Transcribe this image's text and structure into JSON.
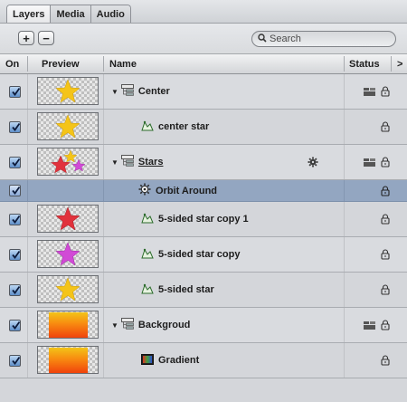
{
  "tabs": [
    {
      "label": "Layers",
      "active": true
    },
    {
      "label": "Media",
      "active": false
    },
    {
      "label": "Audio",
      "active": false
    }
  ],
  "toolbar": {
    "add_label": "+",
    "remove_label": "−",
    "search_placeholder": "Search",
    "search_value": ""
  },
  "columns": {
    "on": "On",
    "preview": "Preview",
    "name": "Name",
    "status": "Status",
    "more": ">"
  },
  "rows": [
    {
      "name": "Center",
      "type": "group",
      "indent": 0,
      "checked": true,
      "preview": "star-yellow",
      "status": [
        "group-icon",
        "lock-icon"
      ]
    },
    {
      "name": "center star",
      "type": "shape",
      "indent": 1,
      "checked": true,
      "preview": "star-yellow",
      "status": [
        "lock-icon"
      ]
    },
    {
      "name": "Stars",
      "type": "group",
      "indent": 0,
      "checked": true,
      "preview": "stars-multi",
      "behavior": "gear-icon",
      "status": [
        "group-icon",
        "lock-icon"
      ]
    },
    {
      "name": "Orbit Around",
      "type": "behavior",
      "indent": 1,
      "checked": true,
      "selected": true,
      "status": [
        "lock-icon"
      ]
    },
    {
      "name": "5-sided star copy 1",
      "type": "shape",
      "indent": 1,
      "checked": true,
      "preview": "star-red",
      "status": [
        "lock-icon"
      ]
    },
    {
      "name": "5-sided star copy",
      "type": "shape",
      "indent": 1,
      "checked": true,
      "preview": "star-magenta",
      "status": [
        "lock-icon"
      ]
    },
    {
      "name": "5-sided star",
      "type": "shape",
      "indent": 1,
      "checked": true,
      "preview": "star-yellow",
      "status": [
        "lock-icon"
      ]
    },
    {
      "name": "Backgroud",
      "type": "group",
      "indent": 0,
      "checked": true,
      "preview": "gradient",
      "status": [
        "group-icon",
        "lock-icon"
      ]
    },
    {
      "name": "Gradient",
      "type": "generator",
      "indent": 1,
      "checked": true,
      "preview": "gradient",
      "status": [
        "lock-icon"
      ]
    }
  ],
  "colors": {
    "selection": "#93a6c1",
    "checkbox": "#5f8fc9",
    "star_yellow": "#f4c419",
    "star_red": "#e1323c",
    "star_magenta": "#d14ad6",
    "gradient_top": "#f2c418",
    "gradient_bottom": "#f0430c"
  }
}
